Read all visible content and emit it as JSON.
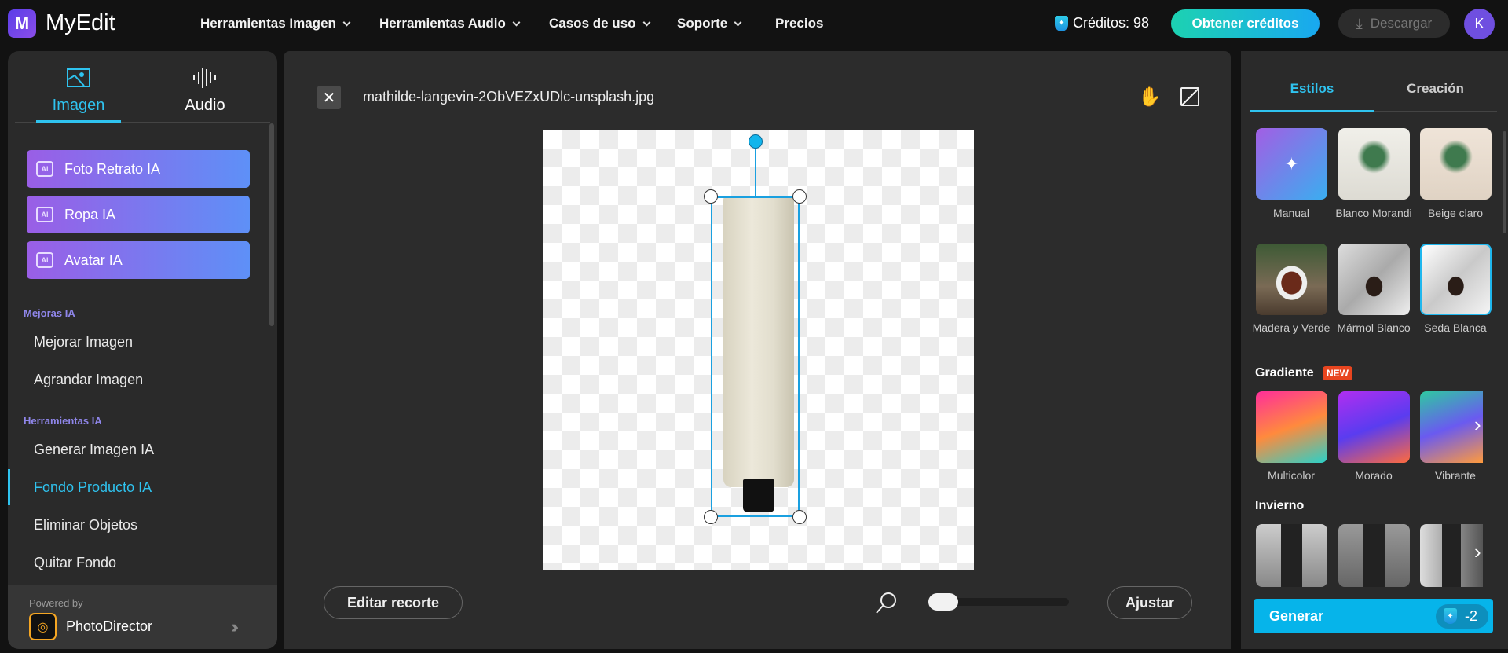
{
  "header": {
    "logo_letter": "M",
    "brand": "MyEdit",
    "nav": [
      "Herramientas Imagen",
      "Herramientas Audio",
      "Casos de uso",
      "Soporte",
      "Precios"
    ],
    "credits": "Créditos: 98",
    "get_credits": "Obtener créditos",
    "download": "Descargar",
    "avatar": "K"
  },
  "left": {
    "tabs": [
      "Imagen",
      "Audio"
    ],
    "ai_buttons": [
      "Foto Retrato IA",
      "Ropa IA",
      "Avatar IA"
    ],
    "ai_badge": "AI",
    "sections": [
      {
        "title": "Mejoras IA",
        "items": [
          "Mejorar Imagen",
          "Agrandar Imagen"
        ]
      },
      {
        "title": "Herramientas IA",
        "items": [
          "Generar Imagen IA",
          "Fondo Producto IA",
          "Eliminar Objetos",
          "Quitar Fondo"
        ]
      }
    ],
    "powered_by": "Powered by",
    "product": "PhotoDirector"
  },
  "editor": {
    "filename": "mathilde-langevin-2ObVEZxUDlc-unsplash.jpg",
    "edit_crop": "Editar recorte",
    "fit": "Ajustar",
    "zoom_value": 0
  },
  "right": {
    "tabs": [
      "Estilos",
      "Creación"
    ],
    "styles": [
      "Manual",
      "Blanco Morandi",
      "Beige claro",
      "Madera y Verde",
      "Mármol Blanco",
      "Seda Blanca"
    ],
    "gradient_title": "Gradiente",
    "new_badge": "NEW",
    "gradients": [
      "Multicolor",
      "Morado",
      "Vibrante"
    ],
    "winter_title": "Invierno",
    "generate": "Generar",
    "cost": "-2"
  },
  "colors": {
    "accent": "#2fc3ef",
    "generate": "#06b4ea"
  }
}
